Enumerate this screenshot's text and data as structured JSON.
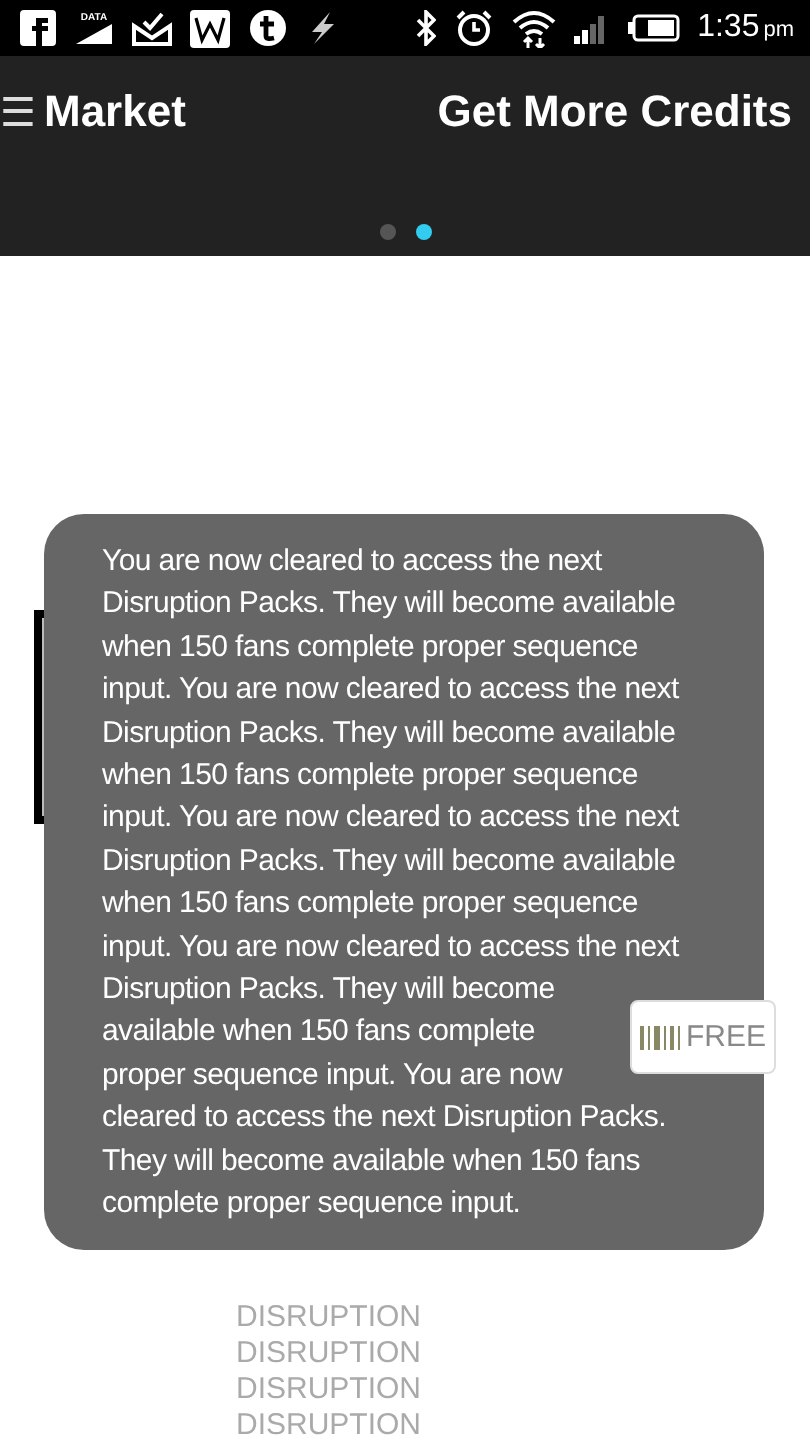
{
  "status_bar": {
    "data_label": "DATA",
    "time": "1:35",
    "meridiem": "pm"
  },
  "app_bar": {
    "menu_icon": "☰",
    "title": "Market",
    "action": "Get More Credits"
  },
  "pager": [
    {
      "selected": false
    },
    {
      "selected": true
    }
  ],
  "pack": {
    "lines": [
      "DISRUPTION",
      "DISRUPTION",
      "DISRUPTION",
      "DISRUPTION"
    ],
    "price": "FREE"
  },
  "toast": {
    "message": "You are now cleared to access the next Disruption Packs. They will become available when 150 fans complete proper sequence input. You are now cleared to access the next Disruption Packs. They will become available when 150 fans complete proper sequence input. You are now cleared to access the next Disruption Packs. They will become available when 150 fans complete proper sequence input. You are now cleared to access the next Disruption Packs. They will become available when 150 fans complete proper sequence input. You are now cleared to access the next Disruption Packs. They will become available when 150 fans complete proper sequence input."
  }
}
